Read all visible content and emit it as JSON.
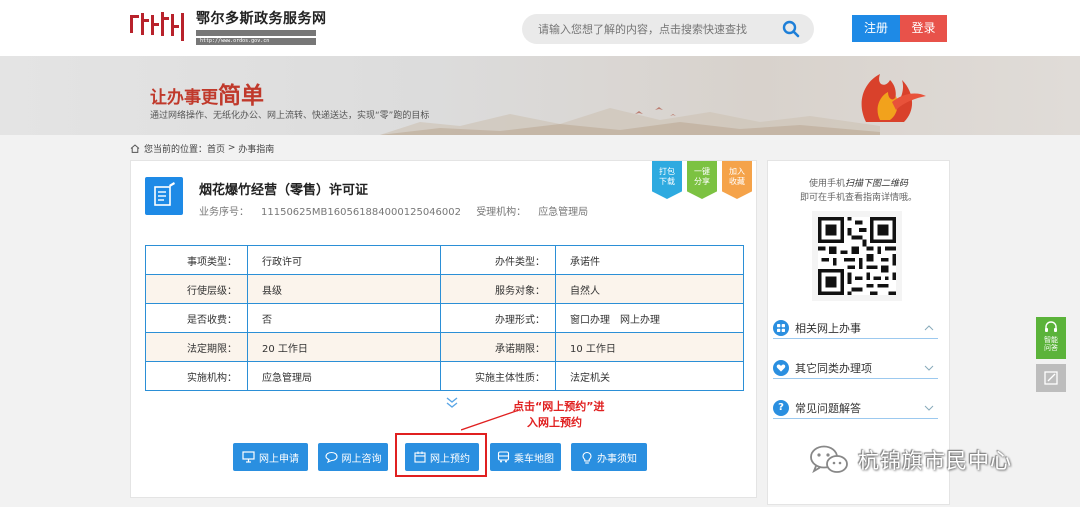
{
  "header": {
    "site_name": "鄂尔多斯政务服务网",
    "site_url": "http://www.ordos.gov.cn",
    "search_placeholder": "请输入您想了解的内容，点击搜索快速查找",
    "register_label": "注册",
    "login_label": "登录",
    "colors": {
      "register": "#1e8ae6",
      "login": "#e8524a"
    }
  },
  "banner": {
    "slogan_prefix": "让办事更",
    "slogan_emphasis": "简单",
    "slogan_sub": "通过网络操作、无纸化办公、网上流转、快递送达，实现“零”跑的目标"
  },
  "breadcrumb": {
    "icon": "home-icon",
    "label": "您当前的位置：",
    "items": [
      "首页",
      "办事指南"
    ],
    "separator": " > "
  },
  "service": {
    "icon": "document-edit-icon",
    "title": "烟花爆竹经营（零售）许可证",
    "code_label": "业务序号：",
    "code": "11150625MB160561884000125046002",
    "agency_label": "受理机构：",
    "agency": "应急管理局",
    "ribbons": [
      {
        "label_1": "打包",
        "label_2": "下载",
        "color": "#2eaae0"
      },
      {
        "label_1": "一键",
        "label_2": "分享",
        "color": "#7cc242"
      },
      {
        "label_1": "加入",
        "label_2": "收藏",
        "color": "#f5a34a"
      }
    ],
    "table": [
      {
        "l1": "事项类型：",
        "v1": "行政许可",
        "l2": "办件类型：",
        "v2": "承诺件"
      },
      {
        "l1": "行使层级：",
        "v1": "县级",
        "l2": "服务对象：",
        "v2": "自然人"
      },
      {
        "l1": "是否收费：",
        "v1": "否",
        "l2": "办理形式：",
        "v2": "窗口办理　网上办理"
      },
      {
        "l1": "法定期限：",
        "v1": "20 工作日",
        "l2": "承诺期限：",
        "v2": "10 工作日"
      },
      {
        "l1": "实施机构：",
        "v1": "应急管理局",
        "l2": "实施主体性质：",
        "v2": "法定机关"
      }
    ],
    "annotation_line_1": "点击“网上预约”进",
    "annotation_line_2": "入网上预约",
    "actions": [
      {
        "label": "网上申请",
        "icon": "monitor-icon"
      },
      {
        "label": "网上咨询",
        "icon": "chat-icon"
      },
      {
        "label": "网上预约",
        "icon": "calendar-icon"
      },
      {
        "label": "乘车地图",
        "icon": "bus-icon"
      },
      {
        "label": "办事须知",
        "icon": "lightbulb-icon"
      }
    ]
  },
  "sidebar": {
    "tip_line_1_pre": "使用手机",
    "tip_line_1_em": "扫描下图二维码",
    "tip_line_2": "即可在手机查看指南详情哦。",
    "items": [
      {
        "label": "相关网上办事",
        "icon": "grid-icon"
      },
      {
        "label": "其它同类办理项",
        "icon": "heart-icon"
      },
      {
        "label": "常见问题解答",
        "icon": "question-icon"
      }
    ]
  },
  "floating": {
    "help_label_1": "智能",
    "help_label_2": "问答"
  },
  "watermark": {
    "text": "杭锦旗市民中心"
  }
}
